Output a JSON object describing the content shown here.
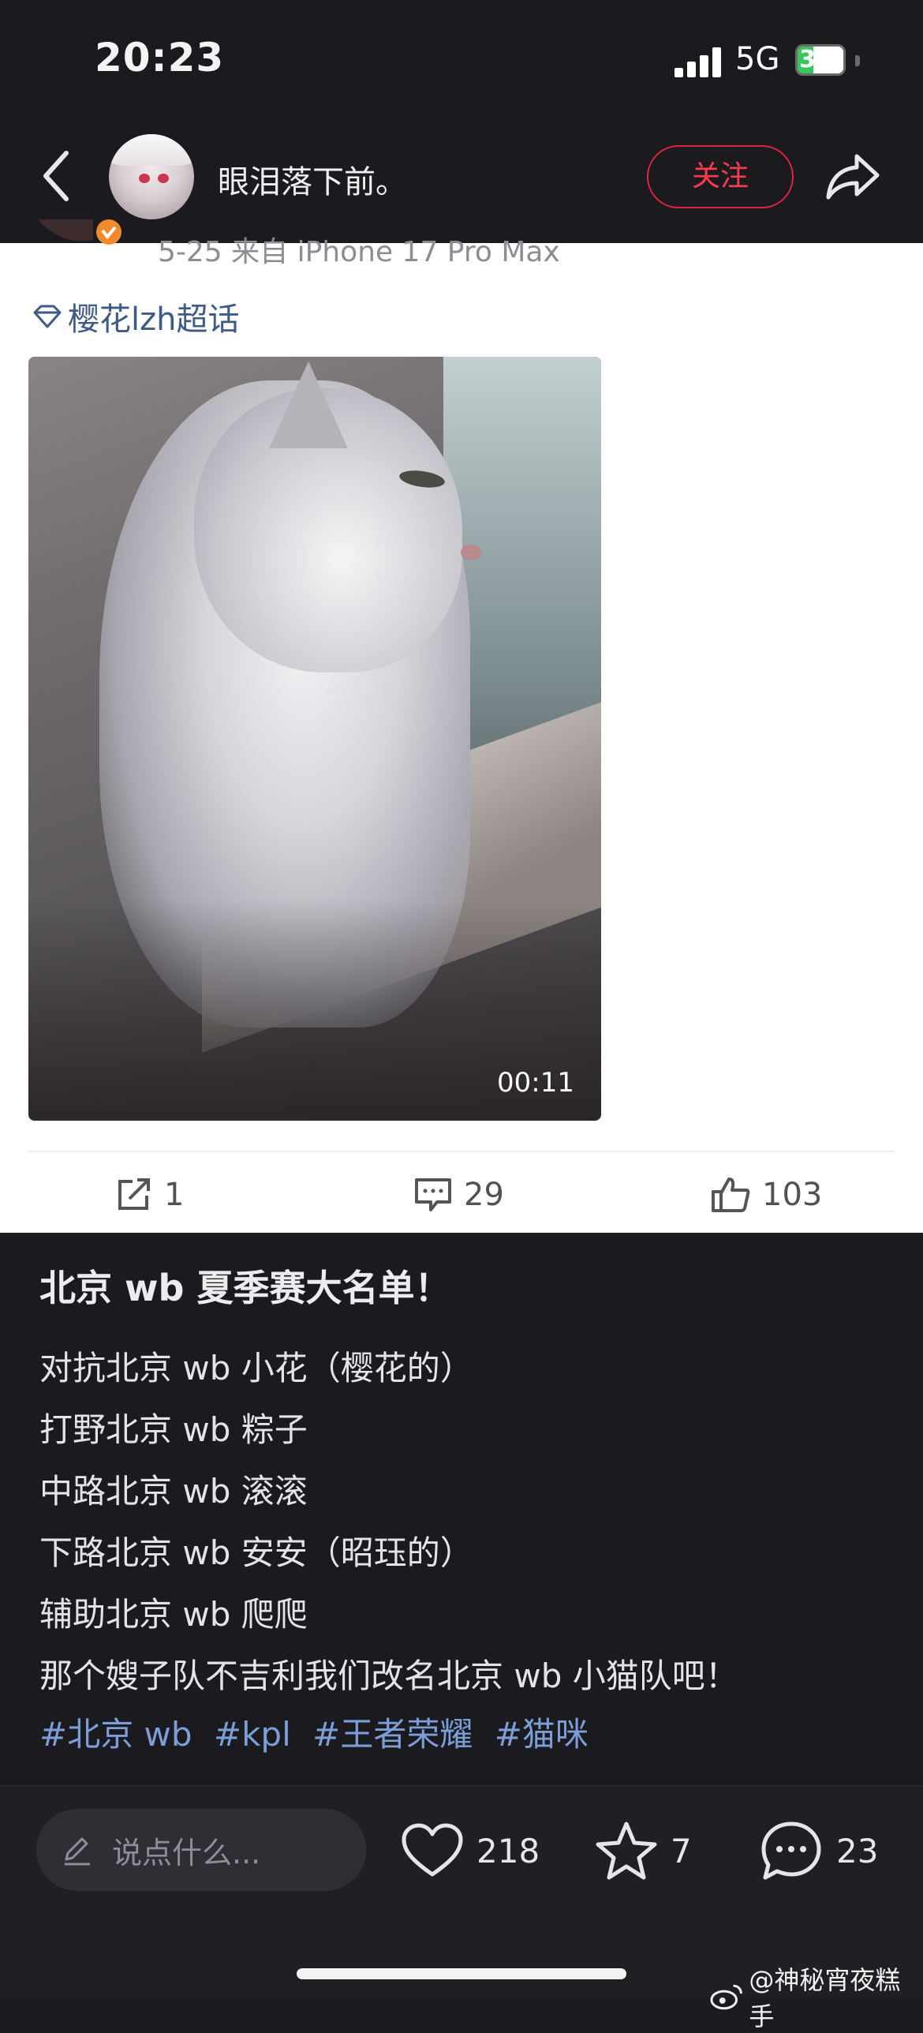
{
  "status_bar": {
    "time": "20:23",
    "network": "5G",
    "battery": "35",
    "battery_level": 0.35
  },
  "header": {
    "nickname": "眼泪落下前。",
    "follow_label": "关注"
  },
  "post": {
    "meta": "5-25  来自 iPhone 17 Pro Max",
    "topic": "樱花lzh超话",
    "video_duration": "00:11",
    "actions": {
      "repost": "1",
      "comment": "29",
      "like": "103"
    }
  },
  "caption": {
    "title": "北京 wb 夏季赛大名单！",
    "lines": [
      "对抗北京 wb 小花（樱花的）",
      "打野北京 wb 粽子",
      "中路北京 wb 滚滚",
      "下路北京 wb 安安（昭珏的）",
      "辅助北京 wb 爬爬",
      "那个嫂子队不吉利我们改名北京 wb 小猫队吧！"
    ],
    "tags": [
      "#北京 wb",
      "#kpl",
      "#王者荣耀",
      "#猫咪"
    ]
  },
  "bottom_bar": {
    "placeholder": "说点什么...",
    "likes": "218",
    "favorites": "7",
    "comments": "23"
  },
  "watermark": "@神秘宵夜糕手",
  "colors": {
    "follow_red": "#ff3b4e",
    "tag_blue": "#7c9ed8",
    "topic_blue": "#3e5a86",
    "dark_bg": "#1a1a1f"
  }
}
